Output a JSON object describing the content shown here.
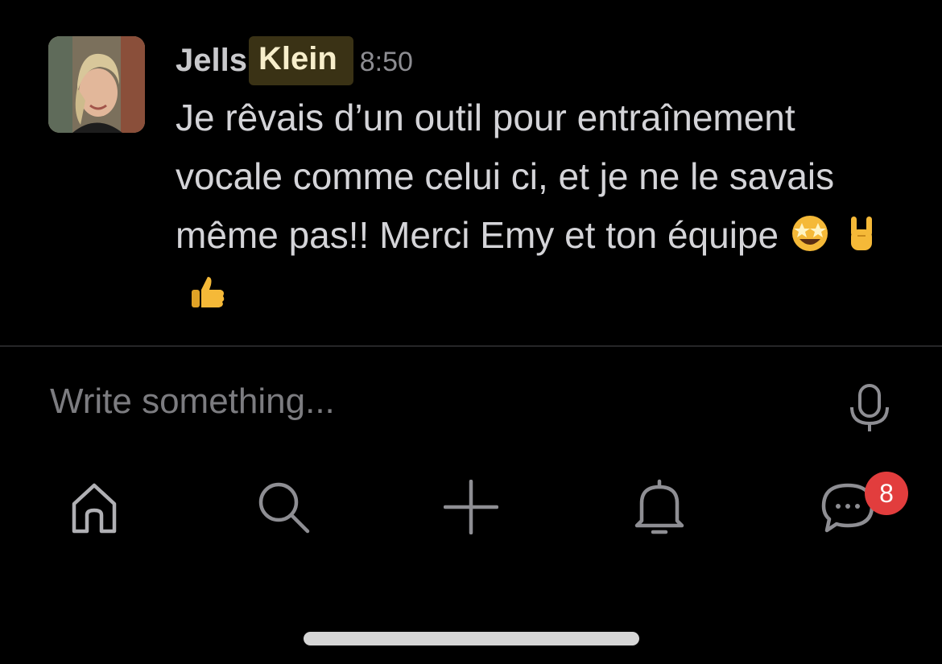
{
  "message": {
    "author_first": "Jells",
    "author_last": "Klein",
    "time": "8:50",
    "body": "Je rêvais d’un outil pour entraînement vocale comme celui ci, et je ne le savais même pas!! Merci Emy et ton équipe",
    "emojis": [
      "star-struck-emoji",
      "rock-on-hand-emoji",
      "thumbs-up-emoji"
    ]
  },
  "composer": {
    "placeholder": "Write something..."
  },
  "tabbar": {
    "tabs": [
      "home-icon",
      "search-icon",
      "plus-icon",
      "bell-icon",
      "chat-icon"
    ],
    "chat_badge": "8"
  },
  "colors": {
    "background": "#000000",
    "highlight": "#3a3215",
    "badge": "#e23d3d",
    "emoji": "#f5b938"
  }
}
